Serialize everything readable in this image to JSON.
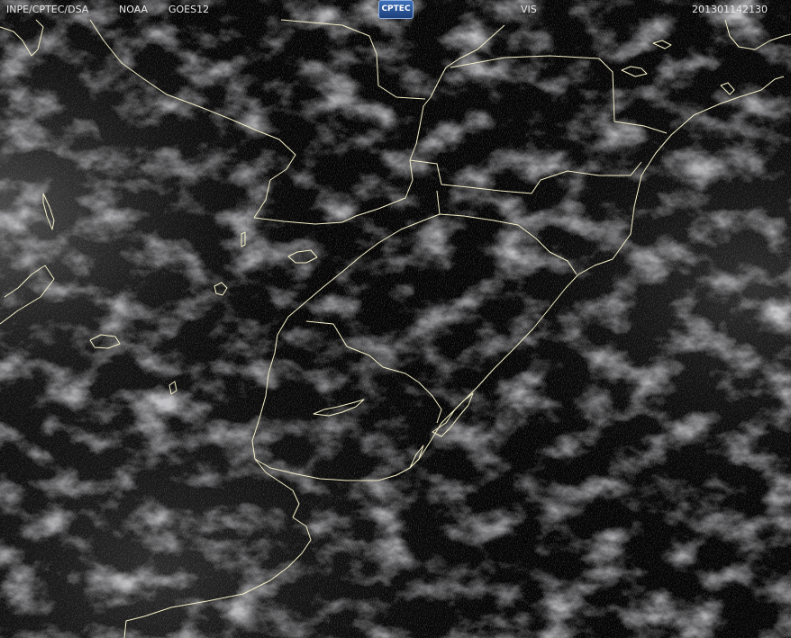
{
  "header": {
    "organization": "INPE/CPTEC/DSA",
    "agency": "NOAA",
    "satellite": "GOES12",
    "channel": "VIS",
    "timestamp": "201301142130",
    "logo_text": "CPTEC"
  },
  "colors": {
    "background": "#000000",
    "borders": "#f4f0c8",
    "header_text": "#e8e8e8",
    "logo": "#2a5aa0"
  }
}
